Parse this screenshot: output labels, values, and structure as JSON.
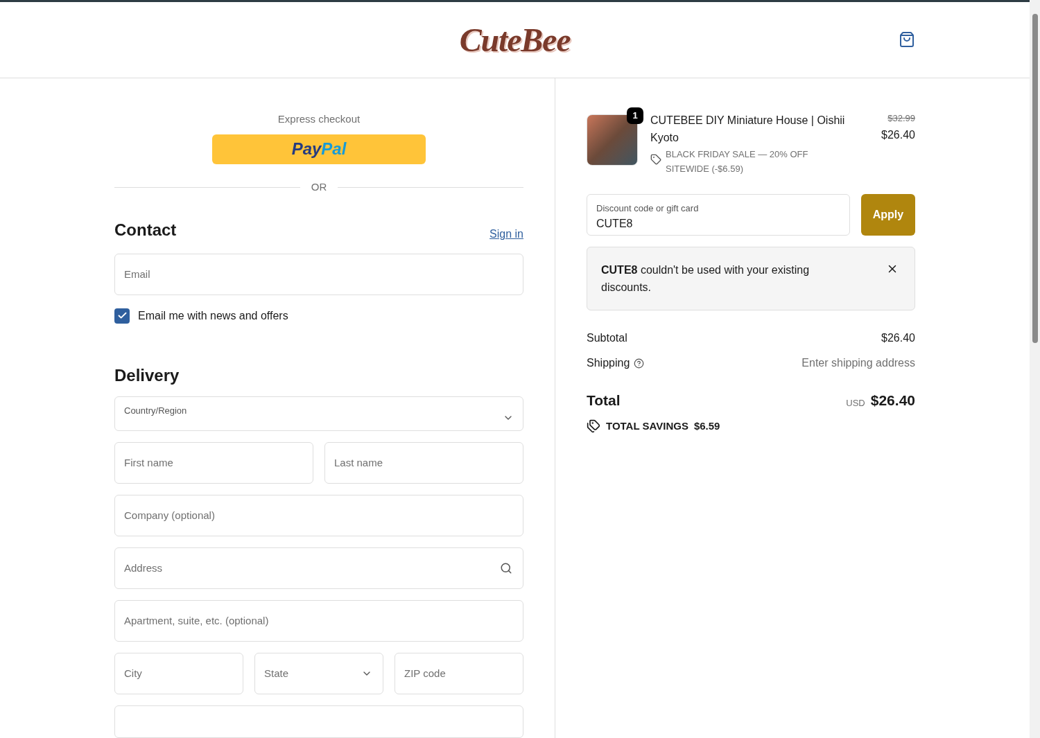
{
  "header": {
    "logo": "CuteBee"
  },
  "express": {
    "title": "Express checkout",
    "paypal": [
      "Pay",
      "Pal"
    ],
    "divider": "OR"
  },
  "contact": {
    "title": "Contact",
    "sign_in": "Sign in",
    "email": {
      "placeholder": "Email"
    },
    "newsletter": {
      "label": "Email me with news and offers",
      "checked": true
    }
  },
  "delivery": {
    "title": "Delivery",
    "country": {
      "label": "Country/Region"
    },
    "fields": [
      [
        {
          "placeholder": "First name"
        },
        {
          "placeholder": "Last name"
        }
      ],
      [
        {
          "placeholder": "Company (optional)"
        }
      ],
      [
        {
          "placeholder": "Address",
          "kind": "search"
        }
      ],
      [
        {
          "placeholder": "Apartment, suite, etc. (optional)"
        }
      ],
      [
        {
          "placeholder": "City"
        },
        {
          "placeholder": "State",
          "kind": "select"
        },
        {
          "placeholder": "ZIP code"
        }
      ]
    ]
  },
  "order": {
    "item": {
      "quantity": "1",
      "name": "CUTEBEE DIY Miniature House | Oishii Kyoto",
      "discount": "BLACK FRIDAY SALE — 20% OFF SITEWIDE (-$6.59)",
      "old_price": "$32.99",
      "price": "$26.40"
    },
    "discount_field": {
      "label": "Discount code or gift card",
      "value": "CUTE8"
    },
    "apply": "Apply",
    "error": "**CUTE8** couldn't be used with your existing discounts.",
    "subtotal": {
      "label": "Subtotal",
      "value": "$26.40"
    },
    "shipping": {
      "label": "Shipping",
      "value": "Enter shipping address"
    },
    "total": {
      "label": "Total",
      "currency": "USD",
      "value": "$26.40"
    },
    "savings": {
      "label": "TOTAL SAVINGS",
      "value": "$6.59"
    }
  }
}
